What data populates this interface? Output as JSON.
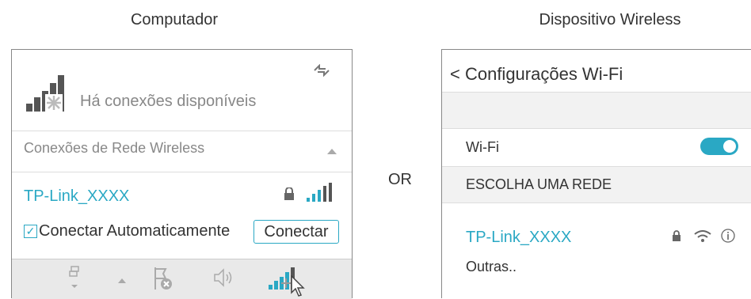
{
  "left": {
    "heading": "Computador",
    "available_text": "Há conexões disponíveis",
    "section_label": "Conexões de Rede Wireless",
    "network_name": "TP-Link_XXXX",
    "auto_connect_label": "Conectar Automaticamente",
    "auto_connect_checked": true,
    "connect_button": "Conectar",
    "taskbar_icons": [
      "network-icon",
      "chevron-up-icon",
      "flag-icon",
      "speaker-icon",
      "wifi-icon",
      "cursor-icon"
    ]
  },
  "middle": {
    "or_label": "OR"
  },
  "right": {
    "heading": "Dispositivo Wireless",
    "title": "< Configurações Wi-Fi",
    "wifi_label": "Wi-Fi",
    "wifi_toggle_on": true,
    "section_label": "ESCOLHA UMA REDE",
    "network_name": "TP-Link_XXXX",
    "other_label": "Outras.."
  },
  "colors": {
    "accent": "#2aa8c4",
    "bar": "#f2f2f2",
    "taskbar": "#e9e9e9"
  }
}
